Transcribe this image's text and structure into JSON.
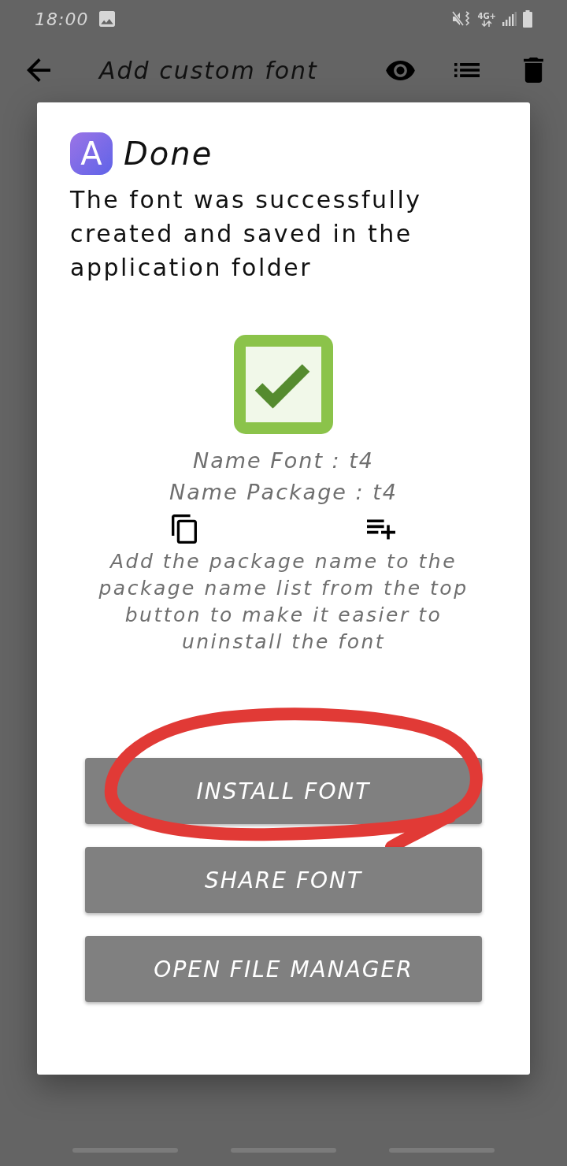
{
  "status_bar": {
    "time": "18:00",
    "network": "4G+"
  },
  "app_bar": {
    "title": "Add custom font"
  },
  "dialog": {
    "icon_letter": "A",
    "title": "Done",
    "message": "The font was successfully created and saved in the application folder",
    "name_font": "Name Font : t4",
    "name_package": "Name Package : t4",
    "hint": "Add the package name to the package name list from the top button to make it easier to uninstall the font",
    "buttons": [
      {
        "label": "INSTALL FONT",
        "circled": true
      },
      {
        "label": "SHARE FONT",
        "circled": false
      },
      {
        "label": "OPEN FILE MANAGER",
        "circled": false
      }
    ]
  }
}
